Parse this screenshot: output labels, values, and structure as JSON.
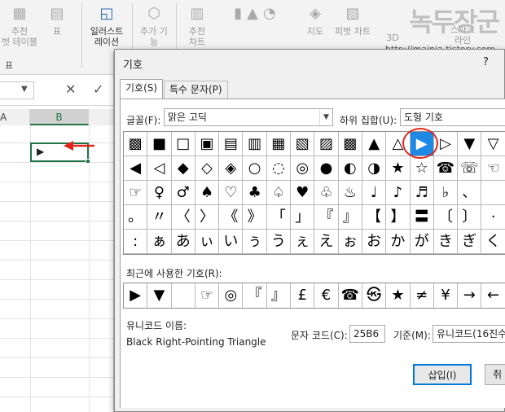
{
  "ribbon": {
    "groups": [
      {
        "label1": "추천",
        "label2": "벗 테이블"
      },
      {
        "label1": "표",
        "label2": ""
      },
      {
        "label1": "일러스트",
        "label2": "레이션"
      },
      {
        "label1": "추가 기",
        "label2": "능"
      },
      {
        "label1": "추천",
        "label2": "차트"
      },
      {
        "label1": "",
        "label2": ""
      },
      {
        "label1": "지도",
        "label2": ""
      },
      {
        "label1": "피벗 차트",
        "label2": ""
      },
      {
        "label1": "3D",
        "label2": ""
      },
      {
        "label1": "스파크",
        "label2": "라인"
      }
    ],
    "footer_label": "표",
    "watermark": "녹두장군",
    "watermark_url": "http://mainia.tistory.com"
  },
  "formula_bar": {
    "cancel_icon": "✕",
    "enter_icon": "✓"
  },
  "sheet": {
    "col_a": "A",
    "col_b": "B",
    "cell_b1_value": "▶"
  },
  "dialog": {
    "title": "기호",
    "help": "?",
    "tabs": [
      "기호(S)",
      "특수 문자(P)"
    ],
    "font_label": "글꼴(F):",
    "font_value": "맑은 고딕",
    "subset_label": "하위 집합(U):",
    "subset_value": "도형 기호",
    "recent_label": "최근에 사용한 기호(R):",
    "unicode_name_label": "유니코드 이름:",
    "unicode_name_value": "Black Right-Pointing Triangle",
    "char_code_label": "문자 코드(C):",
    "char_code_value": "25B6",
    "from_label": "기준(M):",
    "from_value": "유니코드(16진수)",
    "insert_button": "삽입(I)",
    "cancel_button": "취",
    "symbols": [
      [
        "▩",
        "■",
        "□",
        "▣",
        "▤",
        "▥",
        "▦",
        "▧",
        "▨",
        "▩",
        "▲",
        "△",
        "▶",
        "▷",
        "▼",
        "▽"
      ],
      [
        "◀",
        "◁",
        "◆",
        "◇",
        "◈",
        "○",
        "◌",
        "◎",
        "●",
        "◐",
        "◑",
        "★",
        "☆",
        "☎",
        "☏",
        "☜"
      ],
      [
        "☞",
        "♀",
        "♂",
        "♠",
        "♡",
        "♣",
        "♤",
        "♥",
        "♧",
        "♨",
        "♩",
        "♪",
        "♬",
        "♭",
        "、",
        ""
      ],
      [
        "。",
        "〃",
        "〈",
        "〉",
        "《",
        "》",
        "「",
        "」",
        "『",
        "』",
        "【",
        "】",
        "〓",
        "〔",
        "〕",
        "·"
      ],
      [
        ":",
        "ぁ",
        "あ",
        "ぃ",
        "い",
        "ぅ",
        "う",
        "ぇ",
        "え",
        "ぉ",
        "お",
        "か",
        "が",
        "き",
        "ぎ",
        "く"
      ]
    ],
    "selected_symbol_index": 12,
    "recent": [
      "▶",
      "▼",
      "",
      "☞",
      "◎",
      "『",
      "』",
      "£",
      "€",
      "☎",
      "㉿",
      "★",
      "≠",
      "¥",
      "→",
      "←"
    ]
  },
  "colors": {
    "selection": "#1e88e5",
    "excel_green": "#217346",
    "annotation_red": "#e0251b"
  }
}
